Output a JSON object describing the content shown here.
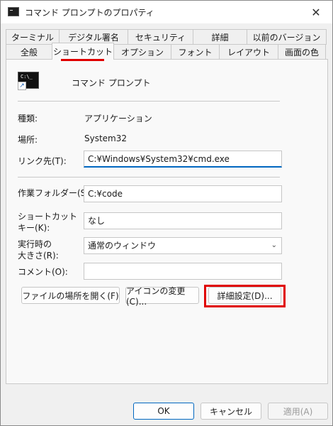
{
  "window": {
    "title": "コマンド プロンプトのプロパティ",
    "close_glyph": "✕"
  },
  "tabs_top": [
    "ターミナル",
    "デジタル署名",
    "セキュリティ",
    "詳細",
    "以前のバージョン"
  ],
  "tabs_bottom": [
    "全般",
    "ショートカット",
    "オプション",
    "フォント",
    "レイアウト",
    "画面の色"
  ],
  "active_tab": "ショートカット",
  "shortcut": {
    "icon_text": "C:\\_",
    "app_name": "コマンド プロンプト",
    "type_label": "種類:",
    "type_value": "アプリケーション",
    "location_label": "場所:",
    "location_value": "System32",
    "target_label": "リンク先(T):",
    "target_value": "C:¥Windows¥System32¥cmd.exe",
    "start_in_label": "作業フォルダー(S):",
    "start_in_value": "C:¥code",
    "shortcut_key_label_1": "ショートカット",
    "shortcut_key_label_2": "キー(K):",
    "shortcut_key_value": "なし",
    "run_label_1": "実行時の",
    "run_label_2": "大きさ(R):",
    "run_value": "通常のウィンドウ",
    "comment_label": "コメント(O):",
    "comment_value": "",
    "open_location_button": "ファイルの場所を開く(F)",
    "change_icon_button": "アイコンの変更(C)...",
    "advanced_button": "詳細設定(D)..."
  },
  "footer": {
    "ok": "OK",
    "cancel": "キャンセル",
    "apply": "適用(A)"
  }
}
